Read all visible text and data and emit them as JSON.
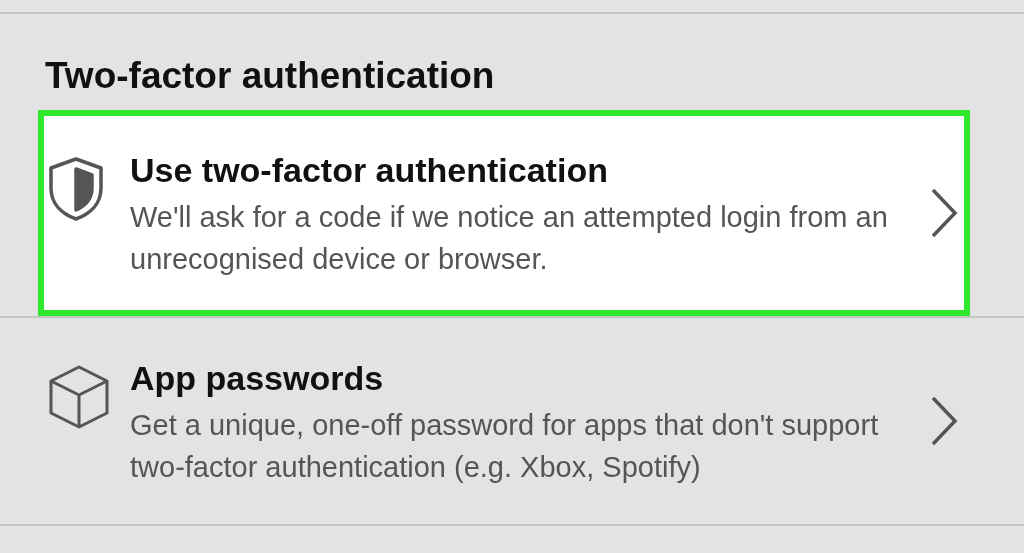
{
  "section": {
    "heading": "Two-factor authentication"
  },
  "items": [
    {
      "kind": "shield",
      "title": "Use two-factor authentication",
      "description": "We'll ask for a code if we notice an attempted login from an unrecognised device or browser.",
      "highlighted": true
    },
    {
      "kind": "cube",
      "title": "App passwords",
      "description": "Get a unique, one-off password for apps that don't support two-factor authentication (e.g. Xbox, Spotify)",
      "highlighted": false
    }
  ]
}
